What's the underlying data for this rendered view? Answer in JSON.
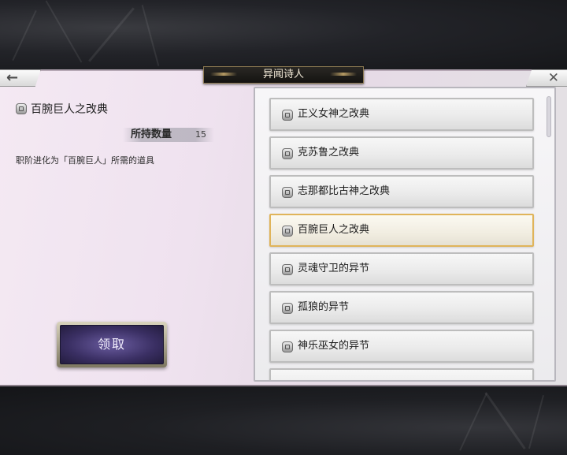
{
  "header": {
    "title": "异闻诗人",
    "back_icon": "arrow-left-icon",
    "close_icon": "close-icon"
  },
  "detail": {
    "item_name": "百腕巨人之改典",
    "quantity_label": "所持数量",
    "quantity_value": "15",
    "description": "职阶进化为「百腕巨人」所需的道具",
    "claim_label": "领取"
  },
  "list": {
    "selected_index": 3,
    "items": [
      {
        "label": "正义女神之改典"
      },
      {
        "label": "克苏鲁之改典"
      },
      {
        "label": "志那都比古神之改典"
      },
      {
        "label": "百腕巨人之改典"
      },
      {
        "label": "灵魂守卫的异节"
      },
      {
        "label": "孤狼的异节"
      },
      {
        "label": "神乐巫女的异节"
      }
    ]
  },
  "colors": {
    "selected_border": "#e0b45a",
    "claim_button": "#3a2f63"
  }
}
